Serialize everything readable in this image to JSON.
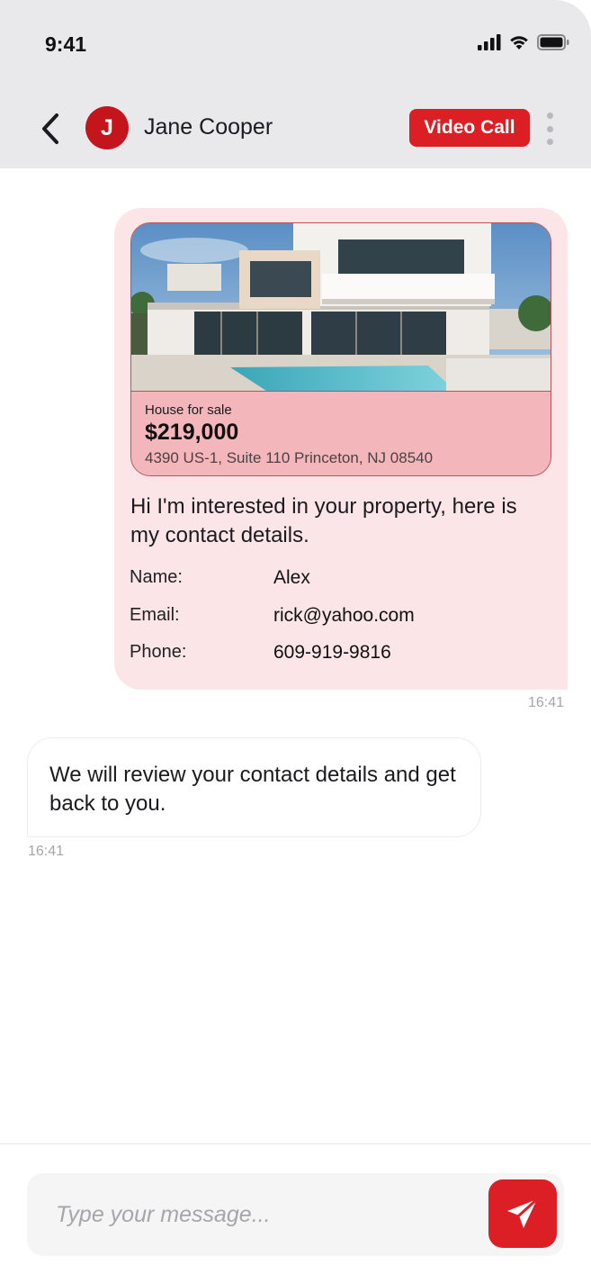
{
  "status_bar": {
    "time": "9:41"
  },
  "header": {
    "avatar_initial": "J",
    "contact_name": "Jane Cooper",
    "video_call_label": "Video Call"
  },
  "outgoing_message": {
    "listing": {
      "label": "House for sale",
      "price": "$219,000",
      "address": "4390 US-1, Suite 110 Princeton, NJ 08540"
    },
    "text": "Hi I'm interested in your property, here is my contact details.",
    "details": [
      {
        "label": "Name:",
        "value": "Alex"
      },
      {
        "label": "Email:",
        "value": "rick@yahoo.com"
      },
      {
        "label": "Phone:",
        "value": "609-919-9816"
      }
    ],
    "time": "16:41"
  },
  "incoming_message": {
    "text": "We will review your contact details and get back to you.",
    "time": "16:41"
  },
  "composer": {
    "placeholder": "Type your message..."
  },
  "colors": {
    "accent": "#dc1e25",
    "avatar": "#c4141c",
    "outgoing_bubble": "#fce5e6",
    "listing_info": "#f3b6ba",
    "header_bg": "#e9e9eb"
  },
  "icons": {
    "back": "chevron-left-icon",
    "more": "more-vertical-icon",
    "send": "send-icon",
    "signal": "signal-icon",
    "wifi": "wifi-icon",
    "battery": "battery-icon"
  }
}
